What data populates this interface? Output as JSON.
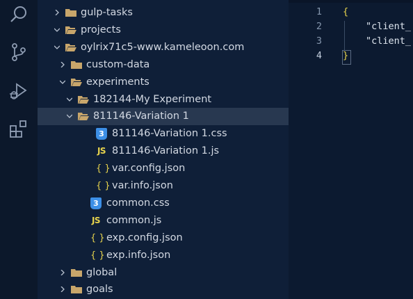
{
  "explorer": {
    "items": [
      {
        "label": "gulp-tasks",
        "type": "folder",
        "expanded": false
      },
      {
        "label": "projects",
        "type": "folder",
        "expanded": true
      },
      {
        "label": "oylrix71c5-www.kameleoon.com",
        "type": "folder",
        "expanded": true
      },
      {
        "label": "custom-data",
        "type": "folder",
        "expanded": false
      },
      {
        "label": "experiments",
        "type": "folder",
        "expanded": true
      },
      {
        "label": "182144-My Experiment",
        "type": "folder",
        "expanded": true
      },
      {
        "label": "811146-Variation 1",
        "type": "folder",
        "expanded": true,
        "selected": true
      },
      {
        "label": "811146-Variation 1.css",
        "type": "css"
      },
      {
        "label": "811146-Variation 1.js",
        "type": "js"
      },
      {
        "label": "var.config.json",
        "type": "json"
      },
      {
        "label": "var.info.json",
        "type": "json"
      },
      {
        "label": "common.css",
        "type": "css"
      },
      {
        "label": "common.js",
        "type": "js"
      },
      {
        "label": "exp.config.json",
        "type": "json"
      },
      {
        "label": "exp.info.json",
        "type": "json"
      },
      {
        "label": "global",
        "type": "folder",
        "expanded": false
      },
      {
        "label": "goals",
        "type": "folder",
        "expanded": false
      }
    ],
    "icon_text": {
      "css": "3",
      "js": "JS",
      "json": "{ }"
    }
  },
  "editor": {
    "line_numbers": [
      "1",
      "2",
      "3",
      "4"
    ],
    "lines": [
      "{",
      "\"client_",
      "\"client_",
      "}"
    ]
  },
  "colors": {
    "folder": "#c8a66b",
    "css_icon": "#3d8fe6",
    "js_icon": "#e8d44d",
    "json_icon": "#e8d44d",
    "selected_row": "#283850",
    "brace": "#e8d44d"
  }
}
